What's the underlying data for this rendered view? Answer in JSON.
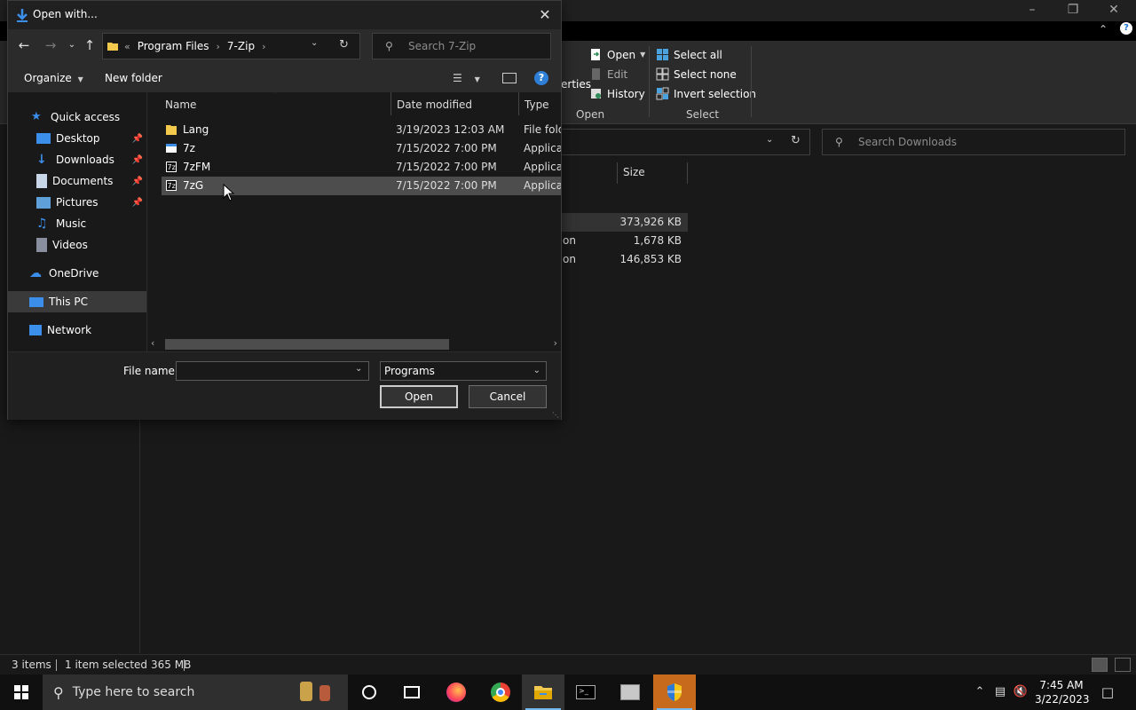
{
  "dialog": {
    "title": "Open with...",
    "breadcrumb": {
      "overflow": "«",
      "items": [
        "Program Files",
        "7-Zip"
      ]
    },
    "search_placeholder": "Search 7-Zip",
    "toolbar": {
      "organize": "Organize",
      "new_folder": "New folder"
    },
    "nav_pane": [
      {
        "label": "Quick access",
        "icon": "star-icon"
      },
      {
        "label": "Desktop",
        "icon": "desktop-icon",
        "pinned": true
      },
      {
        "label": "Downloads",
        "icon": "downloads-icon",
        "pinned": true
      },
      {
        "label": "Documents",
        "icon": "documents-icon",
        "pinned": true
      },
      {
        "label": "Pictures",
        "icon": "pictures-icon",
        "pinned": true
      },
      {
        "label": "Music",
        "icon": "music-icon"
      },
      {
        "label": "Videos",
        "icon": "videos-icon"
      },
      {
        "label": "OneDrive",
        "icon": "cloud-icon"
      },
      {
        "label": "This PC",
        "icon": "computer-icon",
        "selected": true
      },
      {
        "label": "Network",
        "icon": "network-icon"
      }
    ],
    "columns": {
      "name": "Name",
      "date": "Date modified",
      "type": "Type"
    },
    "files": [
      {
        "name": "Lang",
        "date": "3/19/2023 12:03 AM",
        "type": "File folder",
        "icon": "folder-icon"
      },
      {
        "name": "7z",
        "date": "7/15/2022 7:00 PM",
        "type": "Application",
        "icon": "app-icon"
      },
      {
        "name": "7zFM",
        "date": "7/15/2022 7:00 PM",
        "type": "Application",
        "icon": "app-7z-icon"
      },
      {
        "name": "7zG",
        "date": "7/15/2022 7:00 PM",
        "type": "Application",
        "icon": "app-7z-icon",
        "hover": true
      }
    ],
    "file_name_label": "File name:",
    "file_name_value": "",
    "file_type": "Programs",
    "open_button": "Open",
    "cancel_button": "Cancel"
  },
  "background": {
    "ribbon": {
      "open": "Open",
      "edit": "Edit",
      "history": "History",
      "properties_fragment": "erties",
      "select_all": "Select all",
      "select_none": "Select none",
      "invert_selection": "Invert selection",
      "group_open": "Open",
      "group_select": "Select"
    },
    "search_placeholder": "Search Downloads",
    "size_column": "Size",
    "rows": [
      {
        "type_fragment": "",
        "size": "373,926 KB",
        "selected": true
      },
      {
        "type_fragment": "on",
        "size": "1,678 KB"
      },
      {
        "type_fragment": "on",
        "size": "146,853 KB"
      }
    ],
    "status": {
      "items": "3 items",
      "selected": "1 item selected",
      "size": "365 MB"
    }
  },
  "taskbar": {
    "search_placeholder": "Type here to search",
    "time": "7:45 AM",
    "date": "3/22/2023"
  },
  "colors": {
    "accent": "#76b9ed",
    "folder": "#f2c94c"
  }
}
